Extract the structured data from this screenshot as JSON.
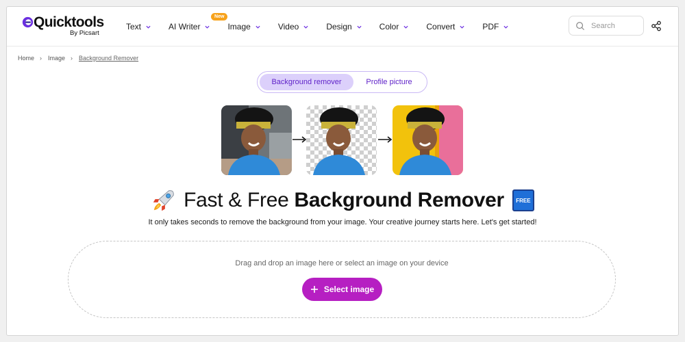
{
  "brand": {
    "name": "Quicktools",
    "sub": "By Picsart"
  },
  "nav": [
    {
      "label": "Text",
      "badge": ""
    },
    {
      "label": "AI Writer",
      "badge": "New"
    },
    {
      "label": "Image",
      "badge": ""
    },
    {
      "label": "Video",
      "badge": ""
    },
    {
      "label": "Design",
      "badge": ""
    },
    {
      "label": "Color",
      "badge": ""
    },
    {
      "label": "Convert",
      "badge": ""
    },
    {
      "label": "PDF",
      "badge": ""
    }
  ],
  "search": {
    "placeholder": "Search"
  },
  "breadcrumb": {
    "home": "Home",
    "section": "Image",
    "current": "Background Remover"
  },
  "tabs": {
    "active": "Background remover",
    "inactive": "Profile picture"
  },
  "headline": {
    "light": "Fast & Free",
    "bold": "Background Remover",
    "badge": "FREE"
  },
  "subhead": "It only takes seconds to remove the background from your image. Your creative journey starts here. Let's get started!",
  "dropzone": {
    "text": "Drag and drop an image here or select an image on your device",
    "button": "Select image"
  },
  "colors": {
    "accent": "#b61fc2",
    "tabActive": "#dcd0fb",
    "tabText": "#5f22c9",
    "badgeNew": "#f7a21b"
  },
  "icons": [
    "logo-mark-icon",
    "chevron-down-icon",
    "search-icon",
    "share-icon",
    "arrow-right-icon",
    "rocket-icon",
    "free-badge-icon",
    "plus-icon"
  ]
}
